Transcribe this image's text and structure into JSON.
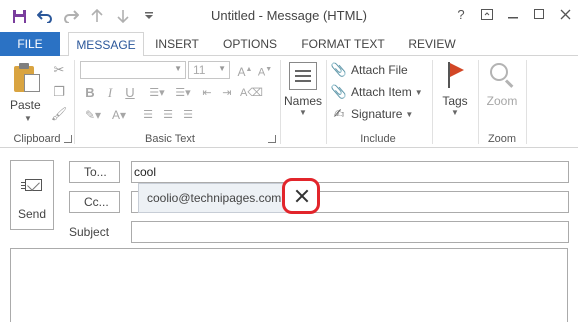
{
  "window": {
    "title": "Untitled - Message (HTML)"
  },
  "quick_access": [
    {
      "name": "save-icon",
      "glyph": "💾"
    },
    {
      "name": "undo-icon",
      "glyph": "↶"
    },
    {
      "name": "redo-icon",
      "glyph": "↷"
    },
    {
      "name": "previous-item-icon",
      "glyph": "↑"
    },
    {
      "name": "next-item-icon",
      "glyph": "↓"
    },
    {
      "name": "customize-toolbar-icon",
      "glyph": "▾"
    }
  ],
  "window_controls": {
    "help": "?",
    "ribbon_options": "❐",
    "minimize": "—",
    "maximize": "☐",
    "close": "✕"
  },
  "tabs": {
    "file": "FILE",
    "message": "MESSAGE",
    "insert": "INSERT",
    "options": "OPTIONS",
    "format_text": "FORMAT TEXT",
    "review": "REVIEW"
  },
  "ribbon": {
    "clipboard": {
      "paste": "Paste",
      "label": "Clipboard"
    },
    "basic_text": {
      "font_size": "11",
      "label": "Basic Text"
    },
    "names": {
      "label": "Names"
    },
    "include": {
      "attach_file": "Attach File",
      "attach_item": "Attach Item",
      "signature": "Signature",
      "label": "Include"
    },
    "tags": {
      "label": "Tags"
    },
    "zoom": {
      "button": "Zoom",
      "label": "Zoom"
    }
  },
  "message": {
    "send": "Send",
    "to_button": "To...",
    "cc_button": "Cc...",
    "subject_label": "Subject",
    "to_value": "cool",
    "cc_value": "",
    "subject_value": "",
    "body_value": ""
  },
  "autocomplete": {
    "suggestion": "coolio@technipages.com"
  },
  "colors": {
    "accent": "#2b72c4",
    "highlight": "#e2252b"
  }
}
